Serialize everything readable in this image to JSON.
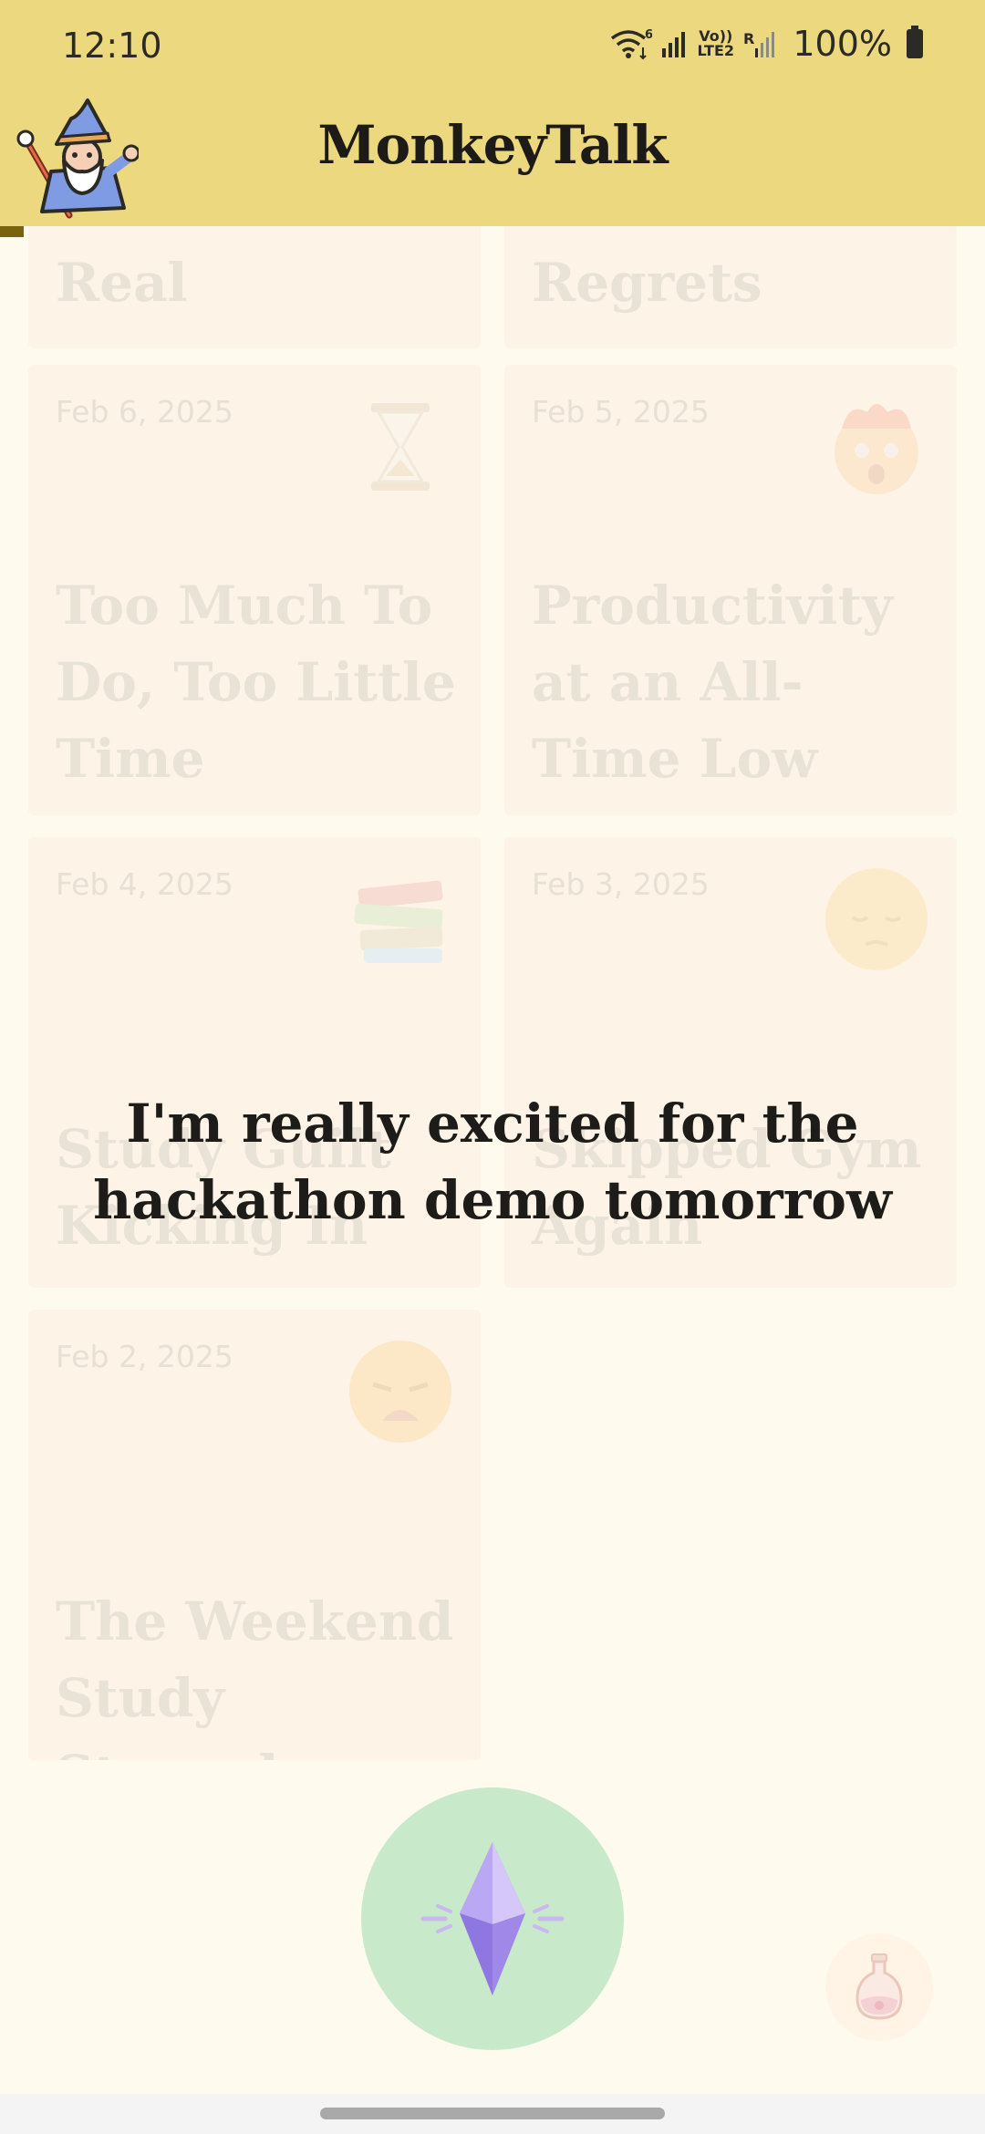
{
  "status_bar": {
    "time": "12:10",
    "wifi_badge": "6",
    "volte_top": "Vo))",
    "volte_bottom": "LTE2",
    "roaming": "R",
    "battery": "100%"
  },
  "header": {
    "title": "MonkeyTalk",
    "avatar_icon": "wizard-icon",
    "background": "#ECD87F"
  },
  "cards": [
    {
      "date": "",
      "title": "Real",
      "emoji": ""
    },
    {
      "date": "",
      "title": "Regrets",
      "emoji": ""
    },
    {
      "date": "Feb 6, 2025",
      "title": "Too Much To Do, Too Little Time",
      "emoji": "hourglass-icon"
    },
    {
      "date": "Feb 5, 2025",
      "title": "Productivity at an All-Time Low",
      "emoji": "exploding-head-icon"
    },
    {
      "date": "Feb 4, 2025",
      "title": "Study Guilt Kicking In",
      "emoji": "books-icon"
    },
    {
      "date": "Feb 3, 2025",
      "title": "Skipped Gym Again",
      "emoji": "pensive-face-icon"
    },
    {
      "date": "Feb 2, 2025",
      "title": "The Weekend Study Struggle",
      "emoji": "weary-face-icon"
    }
  ],
  "overlay": {
    "quote": "I'm really excited for the hackathon demo tomorrow"
  },
  "controls": {
    "record_icon": "crystal-icon",
    "potion_icon": "potion-icon",
    "record_color": "#C8EACB"
  }
}
